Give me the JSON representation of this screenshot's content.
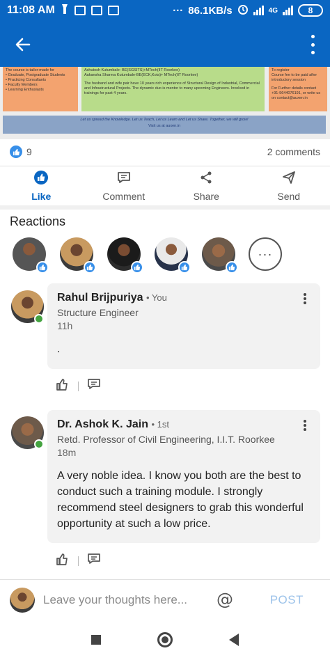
{
  "status_bar": {
    "time": "11:08 AM",
    "speed": "86.1KB/s",
    "network": "4G",
    "battery": "8"
  },
  "app_bar": {
    "back_icon": "arrow-left-icon",
    "menu_icon": "more-vertical-icon"
  },
  "banner": {
    "left_box": [
      "The course is tailor-made for",
      "• Graduate, Postgraduate Students",
      "• Practicing Consultants",
      "• Faculty Members",
      "• Learning Enthusiasts"
    ],
    "middle_box": [
      "Ashutosh Kutumbale- BE(SGSITS)+MTech(IIT Roorkee)",
      "Aakansha Sharma Kutumbale-BE(ECK,Kota)+ MTech(IIT Roorkee)",
      "The husband and wife pair have 10 years rich experience of Structural Design of Industrial, Commercial and Infrastructural Projects. The dynamic duo is mentor to many upcoming Engineers. Involved in trainings for past 4 years."
    ],
    "right_box": [
      "To register",
      "Course fee to be paid after introductory session",
      "For Further details contact +91-9644076191, or write us on contact@auxen.in"
    ],
    "strip_line1": "Let us spread the Knowledge. Let us Teach, Let us Learn and Let us Share. Together, we will grow!",
    "strip_line2": "Visit us at auxen.in"
  },
  "social_counts": {
    "reactions": "9",
    "comments": "2 comments"
  },
  "actions": [
    {
      "label": "Like",
      "icon": "thumbs-up-icon",
      "active": true
    },
    {
      "label": "Comment",
      "icon": "comment-icon",
      "active": false
    },
    {
      "label": "Share",
      "icon": "share-icon",
      "active": false
    },
    {
      "label": "Send",
      "icon": "send-icon",
      "active": false
    }
  ],
  "reactions": {
    "title": "Reactions",
    "more_label": "···"
  },
  "comments": [
    {
      "name": "Rahul Brijpuriya",
      "degree": "• You",
      "headline": "Structure Engineer",
      "time": "11h",
      "text": "."
    },
    {
      "name": "Dr. Ashok K. Jain",
      "degree": "• 1st",
      "headline": "Retd. Professor of Civil Engineering, I.I.T. Roorkee",
      "time": "18m",
      "text": "A very noble idea. I know you both are the best to conduct such a training module. I strongly recommend steel designers to grab this wonderful opportunity at such a low price."
    }
  ],
  "composer": {
    "placeholder": "Leave your thoughts here...",
    "mention_label": "@",
    "post_label": "POST"
  },
  "colors": {
    "brand": "#0a66c2",
    "like_blue": "#378fe9",
    "online_green": "#44a340"
  }
}
